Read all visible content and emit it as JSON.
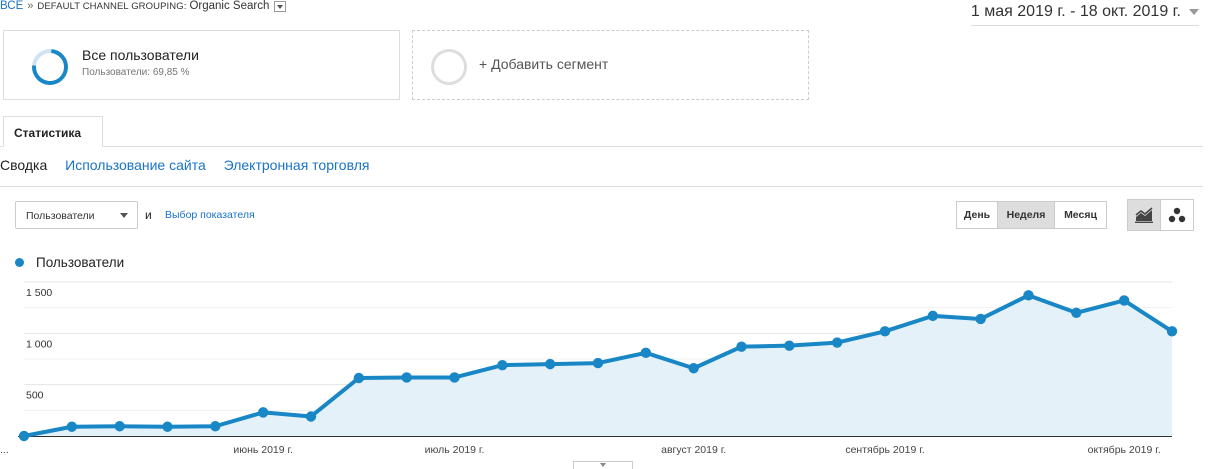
{
  "breadcrumb": {
    "root": "ВСЕ",
    "separator": "»",
    "path": "DEFAULT CHANNEL GROUPING:",
    "segment": "Organic Search"
  },
  "date_range": "1 мая 2019 г. - 18 окт. 2019 г.",
  "segments": {
    "all": {
      "title": "Все пользователи",
      "subtitle": "Пользователи: 69,85 %"
    },
    "add": {
      "label": "+ Добавить сегмент"
    }
  },
  "tabs": [
    {
      "label": "Статистика"
    }
  ],
  "subnav": [
    {
      "label": "Сводка",
      "active": true
    },
    {
      "label": "Использование сайта",
      "active": false
    },
    {
      "label": "Электронная торговля",
      "active": false
    }
  ],
  "metric": {
    "selected": "Пользователи",
    "and": "и",
    "choose": "Выбор показателя"
  },
  "period_buttons": [
    {
      "label": "День",
      "selected": false
    },
    {
      "label": "Неделя",
      "selected": true
    },
    {
      "label": "Месяц",
      "selected": false
    }
  ],
  "chart_buttons": [
    {
      "icon": "line-chart-icon",
      "selected": true
    },
    {
      "icon": "motion-chart-icon",
      "selected": false
    }
  ],
  "colors": {
    "series": "#1987c5",
    "fill": "#e5f1f9",
    "link": "#1a73c8"
  },
  "chart_data": {
    "type": "area",
    "series": [
      {
        "name": "Пользователи",
        "values": [
          0,
          90,
          95,
          90,
          95,
          230,
          190,
          565,
          570,
          570,
          690,
          700,
          710,
          810,
          660,
          870,
          880,
          910,
          1020,
          1170,
          1140,
          1370,
          1200,
          1320,
          1020
        ]
      }
    ],
    "ylim": [
      0,
      1500
    ],
    "yticks": [
      {
        "value": 500,
        "label": "500"
      },
      {
        "value": 1000,
        "label": "1 000"
      },
      {
        "value": 1500,
        "label": "1 500"
      }
    ],
    "xticks": [
      {
        "index": 0,
        "label": "..."
      },
      {
        "index": 5,
        "label": "июнь 2019 г."
      },
      {
        "index": 9,
        "label": "июль 2019 г."
      },
      {
        "index": 14,
        "label": "август 2019 г."
      },
      {
        "index": 18,
        "label": "сентябрь 2019 г."
      },
      {
        "index": 23,
        "label": "октябрь 2019 г."
      }
    ],
    "grid": true
  }
}
